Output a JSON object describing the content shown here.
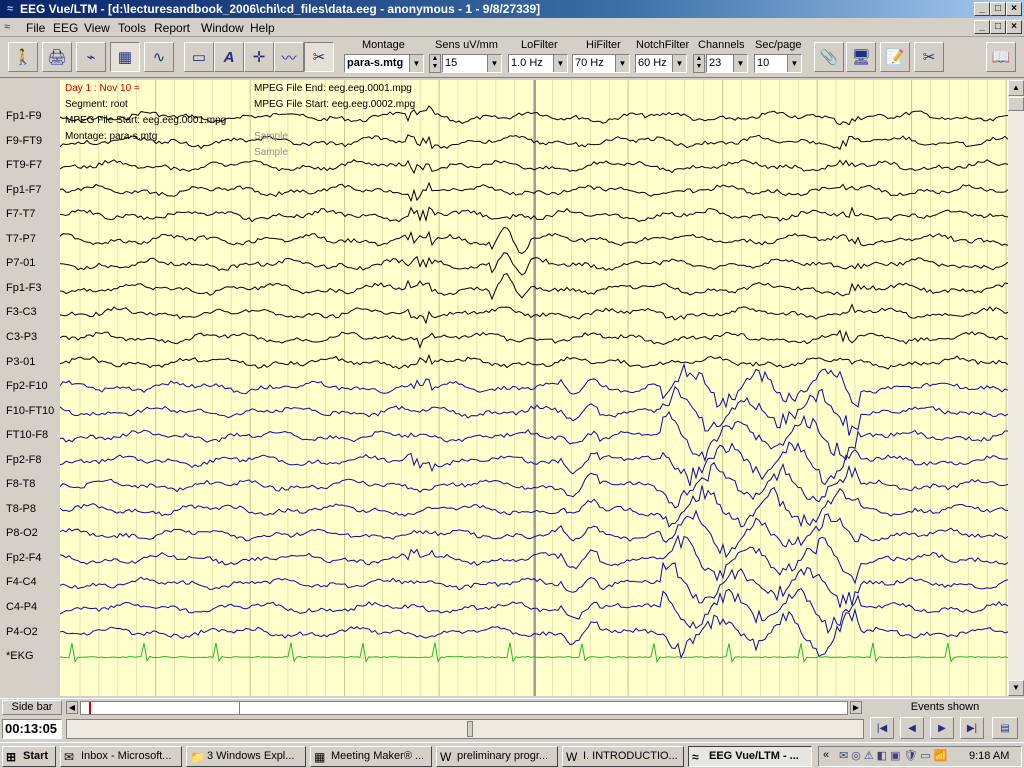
{
  "window": {
    "title": "EEG Vue/LTM - [d:\\lecturesandbook_2006\\chi\\cd_files\\data.eeg - anonymous - 1 - 9/8/27339]"
  },
  "menu": [
    "File",
    "EEG",
    "View",
    "Tools",
    "Report",
    "Window",
    "Help"
  ],
  "toolbar": {
    "montage": {
      "label": "Montage",
      "value": "para-s.mtg"
    },
    "sens": {
      "label": "Sens uV/mm",
      "value": "15"
    },
    "lofilter": {
      "label": "LoFilter",
      "value": "1.0 Hz"
    },
    "hifilter": {
      "label": "HiFilter",
      "value": "70 Hz"
    },
    "notch": {
      "label": "NotchFilter",
      "value": "60 Hz"
    },
    "channels": {
      "label": "Channels",
      "value": "23"
    },
    "secpage": {
      "label": "Sec/page",
      "value": "10"
    },
    "left_icons": [
      "person-icon",
      "printer-icon",
      "electrode-icon",
      "grid-icon",
      "spectrum-icon",
      "rectangle-icon",
      "annotation-a-icon",
      "crosshair-icon",
      "waveform-icon",
      "scissors-icon"
    ],
    "right_icons": [
      "paperclip-icon",
      "computer-icon",
      "notes-icon",
      "tools-cut-icon",
      "book-icon"
    ]
  },
  "annotations": {
    "day": "Day 1 : Nov 10 =",
    "segment": "Segment: root",
    "mpeg_start_1": "MPEG File Start: eeg.eeg.0001.mpg",
    "montage": "Montage: para-s.mtg",
    "mpeg_end": "MPEG File End: eeg.eeg.0001.mpg",
    "mpeg_start_2": "MPEG File Start: eeg.eeg.0002.mpg",
    "sample1": "Sample",
    "sample2": "Sample"
  },
  "channels": [
    {
      "name": "Fp1-F9",
      "color": "#000000"
    },
    {
      "name": "F9-FT9",
      "color": "#000000"
    },
    {
      "name": "FT9-F7",
      "color": "#000000"
    },
    {
      "name": "Fp1-F7",
      "color": "#000000"
    },
    {
      "name": "F7-T7",
      "color": "#000000"
    },
    {
      "name": "T7-P7",
      "color": "#000000"
    },
    {
      "name": "P7-01",
      "color": "#000000"
    },
    {
      "name": "Fp1-F3",
      "color": "#000000"
    },
    {
      "name": "F3-C3",
      "color": "#000000"
    },
    {
      "name": "C3-P3",
      "color": "#000000"
    },
    {
      "name": "P3-01",
      "color": "#000000"
    },
    {
      "name": "Fp2-F10",
      "color": "#0a0aa8"
    },
    {
      "name": "F10-FT10",
      "color": "#0a0aa8"
    },
    {
      "name": "FT10-F8",
      "color": "#0a0aa8"
    },
    {
      "name": "Fp2-F8",
      "color": "#0a0aa8"
    },
    {
      "name": "F8-T8",
      "color": "#0a0aa8"
    },
    {
      "name": "T8-P8",
      "color": "#0a0aa8"
    },
    {
      "name": "P8-O2",
      "color": "#0a0aa8"
    },
    {
      "name": "Fp2-F4",
      "color": "#0a0aa8"
    },
    {
      "name": "F4-C4",
      "color": "#0a0aa8"
    },
    {
      "name": "C4-P4",
      "color": "#0a0aa8"
    },
    {
      "name": "P4-O2",
      "color": "#0a0aa8"
    },
    {
      "name": "*EKG",
      "color": "#22bb22"
    }
  ],
  "bottom": {
    "sidebar": "Side bar",
    "time": "00:13:05",
    "events": "Events shown"
  },
  "taskbar": {
    "start": "Start",
    "tasks": [
      "Inbox - Microsoft...",
      "3 Windows Expl...",
      "Meeting Maker® ...",
      "preliminary progr...",
      "I. INTRODUCTIO...",
      "EEG Vue/LTM - ..."
    ],
    "clock": "9:18 AM"
  }
}
